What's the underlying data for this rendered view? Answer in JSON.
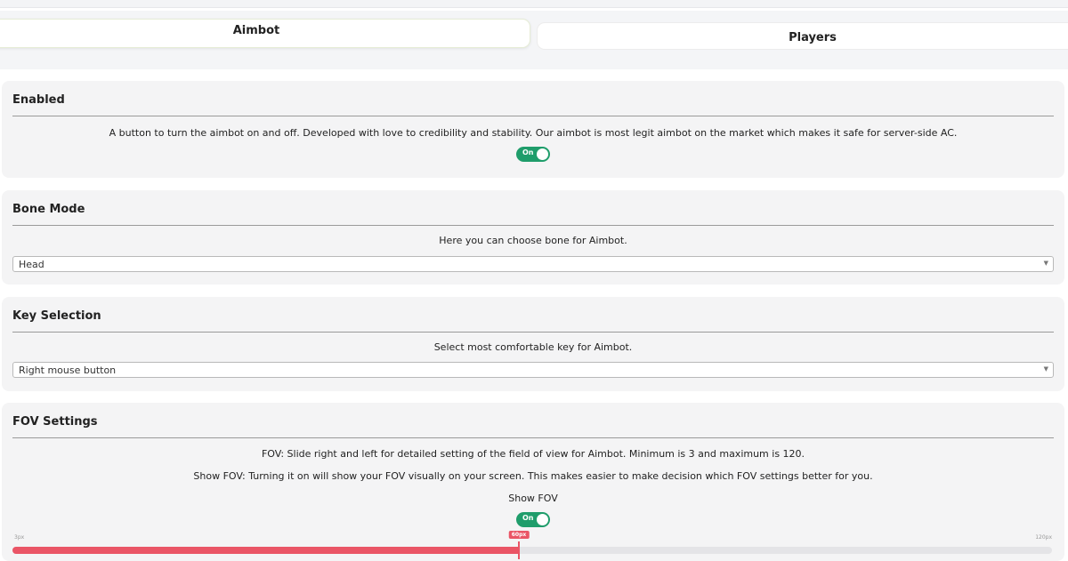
{
  "tabs": {
    "aimbot": "Aimbot",
    "players": "Players"
  },
  "sections": {
    "enabled": {
      "title": "Enabled",
      "description": "A button to turn the aimbot on and off. Developed with love to credibility and stability. Our aimbot is most legit aimbot on the market which makes it safe for server-side AC.",
      "toggle_label": "On"
    },
    "bone_mode": {
      "title": "Bone Mode",
      "description": "Here you can choose bone for Aimbot.",
      "selected": "Head"
    },
    "key_selection": {
      "title": "Key Selection",
      "description": "Select most comfortable key for Aimbot.",
      "selected": "Right mouse button"
    },
    "fov_settings": {
      "title": "FOV Settings",
      "description_fov": "FOV: Slide right and left for detailed setting of the field of view for Aimbot. Minimum is 3 and maximum is 120.",
      "description_show_fov": "Show FOV: Turning it on will show your FOV visually on your screen. This makes easier to make decision which FOV settings better for you.",
      "show_fov_label": "Show FOV",
      "toggle_label": "On",
      "slider": {
        "min_label": "3px",
        "max_label": "120px",
        "value_label": "60px",
        "min": 3,
        "max": 120,
        "value": 60
      }
    }
  },
  "colors": {
    "toggle_on": "#1f9d6b",
    "slider_accent": "#ea5566",
    "card_bg": "#f4f4f5"
  },
  "icons": {
    "dropdown": "chevron-down-icon"
  }
}
